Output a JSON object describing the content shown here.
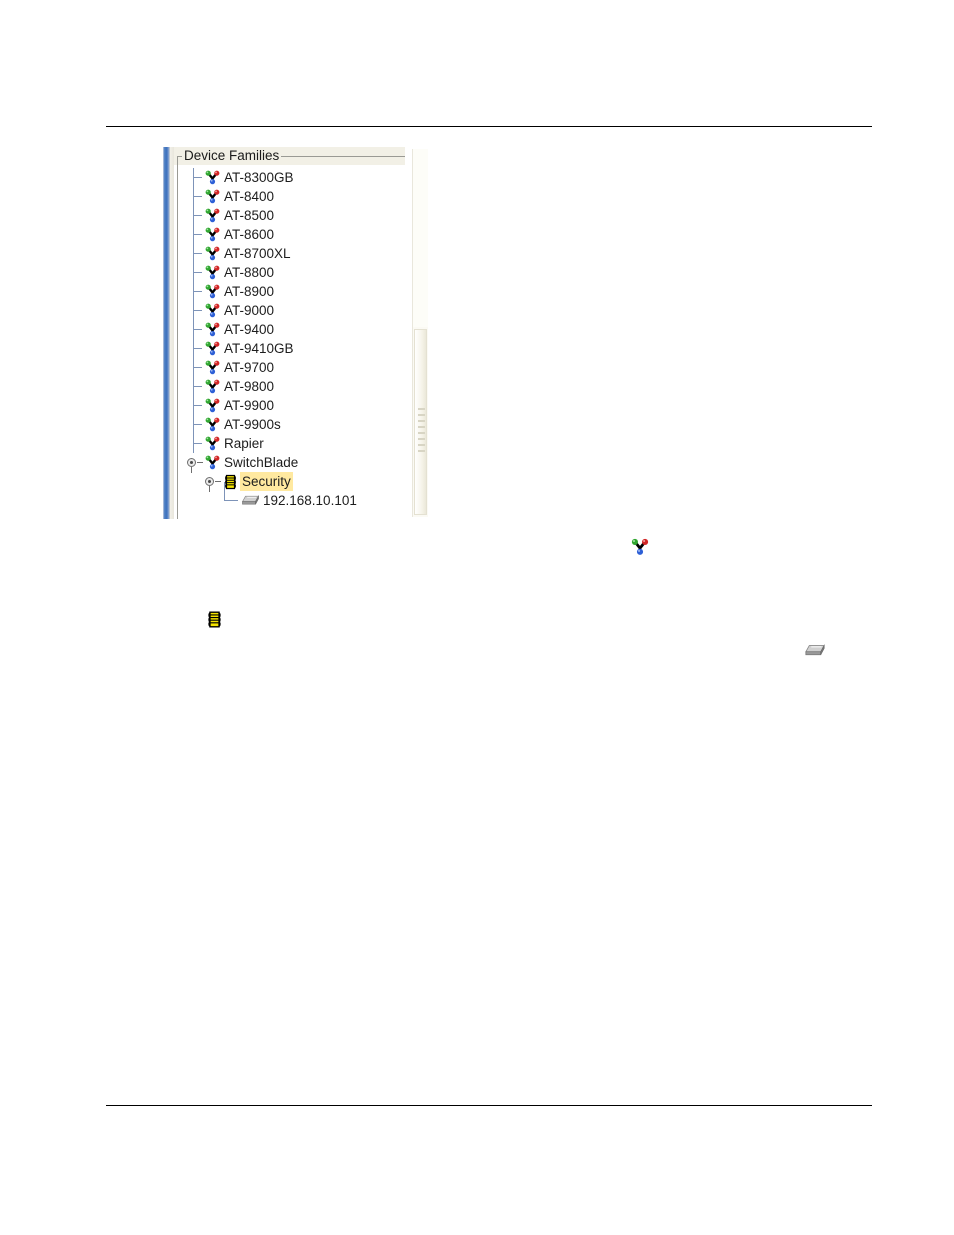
{
  "document": {
    "rules": {
      "top_label": "header-rule",
      "bottom_label": "footer-rule"
    }
  },
  "screenshot": {
    "panel": {
      "title": "Device Families",
      "title_icon": "group-box-titled-border"
    },
    "tree": {
      "nodes": [
        {
          "label": "AT-8300GB",
          "icon": "device-family-icon",
          "depth": 1,
          "expandable": false,
          "selected": false
        },
        {
          "label": "AT-8400",
          "icon": "device-family-icon",
          "depth": 1,
          "expandable": false,
          "selected": false
        },
        {
          "label": "AT-8500",
          "icon": "device-family-icon",
          "depth": 1,
          "expandable": false,
          "selected": false
        },
        {
          "label": "AT-8600",
          "icon": "device-family-icon",
          "depth": 1,
          "expandable": false,
          "selected": false
        },
        {
          "label": "AT-8700XL",
          "icon": "device-family-icon",
          "depth": 1,
          "expandable": false,
          "selected": false
        },
        {
          "label": "AT-8800",
          "icon": "device-family-icon",
          "depth": 1,
          "expandable": false,
          "selected": false
        },
        {
          "label": "AT-8900",
          "icon": "device-family-icon",
          "depth": 1,
          "expandable": false,
          "selected": false
        },
        {
          "label": "AT-9000",
          "icon": "device-family-icon",
          "depth": 1,
          "expandable": false,
          "selected": false
        },
        {
          "label": "AT-9400",
          "icon": "device-family-icon",
          "depth": 1,
          "expandable": false,
          "selected": false
        },
        {
          "label": "AT-9410GB",
          "icon": "device-family-icon",
          "depth": 1,
          "expandable": false,
          "selected": false
        },
        {
          "label": "AT-9700",
          "icon": "device-family-icon",
          "depth": 1,
          "expandable": false,
          "selected": false
        },
        {
          "label": "AT-9800",
          "icon": "device-family-icon",
          "depth": 1,
          "expandable": false,
          "selected": false
        },
        {
          "label": "AT-9900",
          "icon": "device-family-icon",
          "depth": 1,
          "expandable": false,
          "selected": false
        },
        {
          "label": "AT-9900s",
          "icon": "device-family-icon",
          "depth": 1,
          "expandable": false,
          "selected": false
        },
        {
          "label": "Rapier",
          "icon": "device-family-icon",
          "depth": 1,
          "expandable": false,
          "selected": false
        },
        {
          "label": "SwitchBlade",
          "icon": "device-family-icon",
          "depth": 1,
          "expandable": true,
          "expanded": true,
          "selected": false
        },
        {
          "label": "Security",
          "icon": "security-icon",
          "depth": 2,
          "expandable": true,
          "expanded": true,
          "selected": true
        },
        {
          "label": "192.168.10.101",
          "icon": "device-icon",
          "depth": 3,
          "expandable": false,
          "selected": false
        }
      ]
    },
    "scrollbar": {
      "orientation": "vertical",
      "name": "tree-vertical-scrollbar"
    }
  },
  "body_icons": [
    {
      "name": "device-family-icon",
      "alt": "device family"
    },
    {
      "name": "security-icon",
      "alt": "security group"
    },
    {
      "name": "device-icon",
      "alt": "managed device"
    }
  ],
  "colors": {
    "selection_background": "#ffe9a0",
    "splitter_blue": "#3f72bd",
    "tree_line": "#7d93b8",
    "panel_title_background": "#f2f0e6",
    "icon_green": "#2fa52f",
    "icon_red": "#d12626",
    "icon_blue": "#2d5fd6",
    "security_yellow": "#f5e400",
    "device_gray": "#a8a8a8"
  }
}
